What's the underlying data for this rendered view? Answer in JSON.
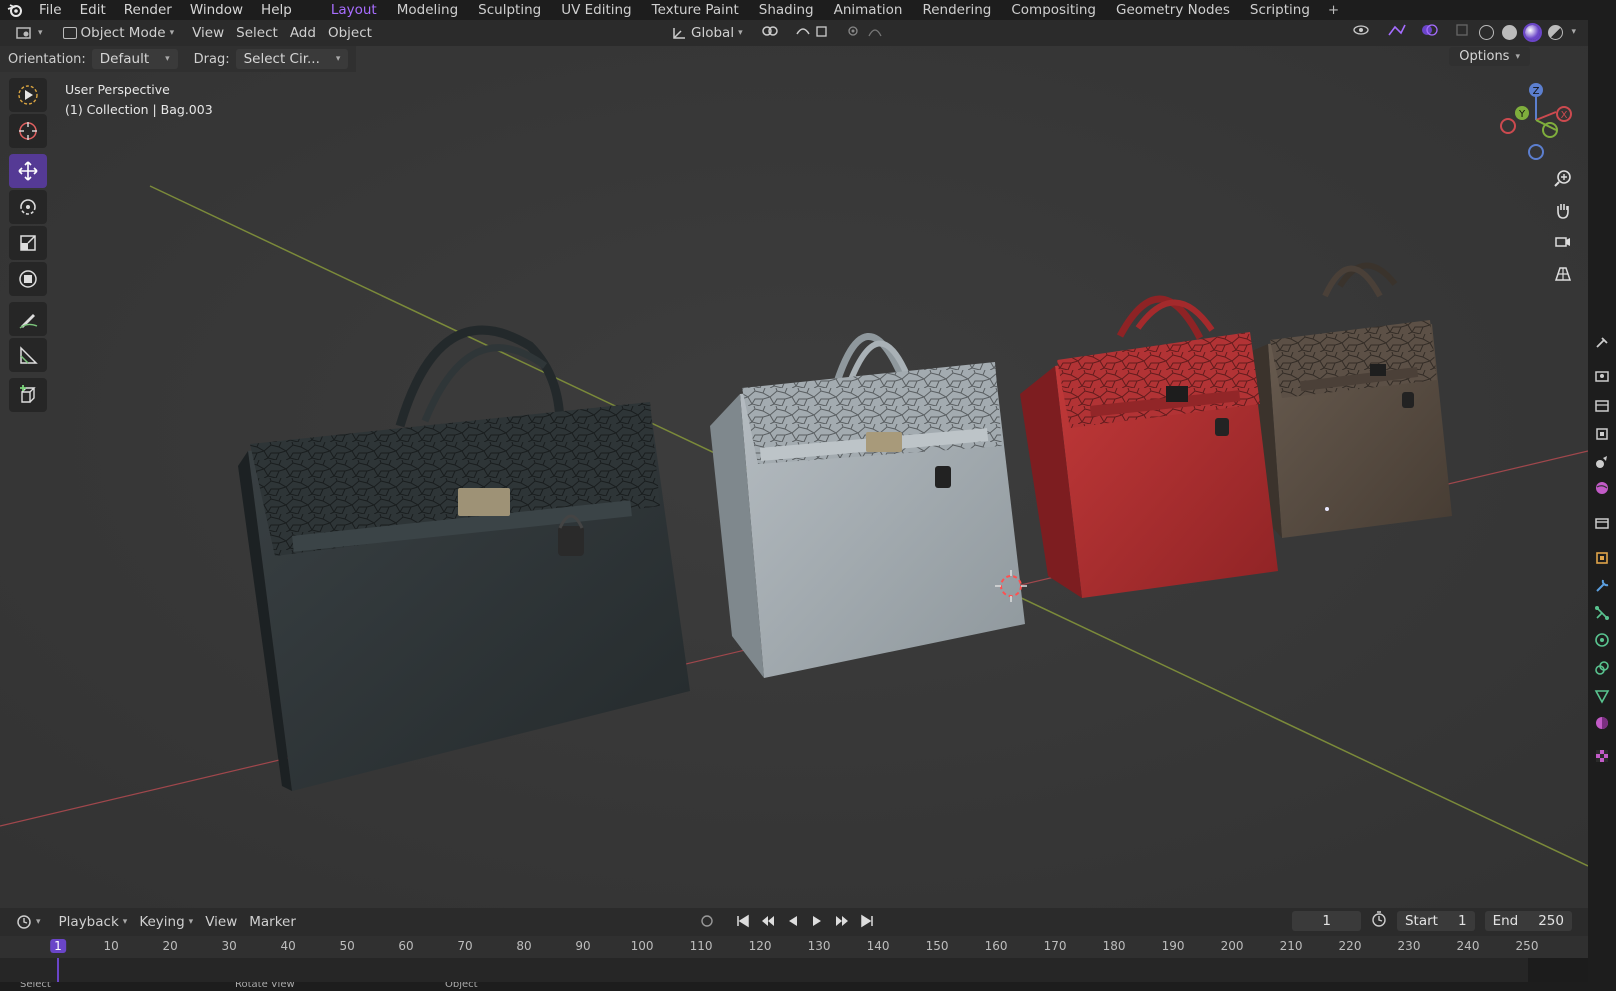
{
  "app": {
    "menus": [
      "File",
      "Edit",
      "Render",
      "Window",
      "Help"
    ],
    "workspaces": [
      "Layout",
      "Modeling",
      "Sculpting",
      "UV Editing",
      "Texture Paint",
      "Shading",
      "Animation",
      "Rendering",
      "Compositing",
      "Geometry Nodes",
      "Scripting"
    ],
    "active_workspace": "Layout",
    "add_workspace": "+"
  },
  "viewport_header": {
    "mode": "Object Mode",
    "menus": [
      "View",
      "Select",
      "Add",
      "Object"
    ],
    "transform_orientation": "Global"
  },
  "tool_settings": {
    "orientation_label": "Orientation:",
    "orientation_value": "Default",
    "drag_label": "Drag:",
    "drag_value": "Select Cir...",
    "options_label": "Options"
  },
  "viewport": {
    "perspective": "User Perspective",
    "collection_info": "(1) Collection | Bag.003",
    "accent_color": "#6a45c8",
    "objects": [
      {
        "name": "black-bag",
        "color": "#2f3537"
      },
      {
        "name": "grey-bag",
        "color": "#a7afb4"
      },
      {
        "name": "red-bag",
        "color": "#b53233"
      },
      {
        "name": "brown-bag",
        "color": "#5a4e44"
      }
    ]
  },
  "gizmo": {
    "z": "Z",
    "y": "Y",
    "x": "X"
  },
  "timeline": {
    "menus": [
      "Playback",
      "Keying",
      "View",
      "Marker"
    ],
    "current_frame": "1",
    "start_label": "Start",
    "start_value": "1",
    "end_label": "End",
    "end_value": "250",
    "ruler_ticks": [
      "1",
      "10",
      "20",
      "30",
      "40",
      "50",
      "60",
      "70",
      "80",
      "90",
      "100",
      "110",
      "120",
      "130",
      "140",
      "150",
      "160",
      "170",
      "180",
      "190",
      "200",
      "210",
      "220",
      "230",
      "240",
      "250"
    ]
  },
  "statusbar": {
    "items": [
      "Select",
      "Rotate View",
      "Object"
    ]
  }
}
